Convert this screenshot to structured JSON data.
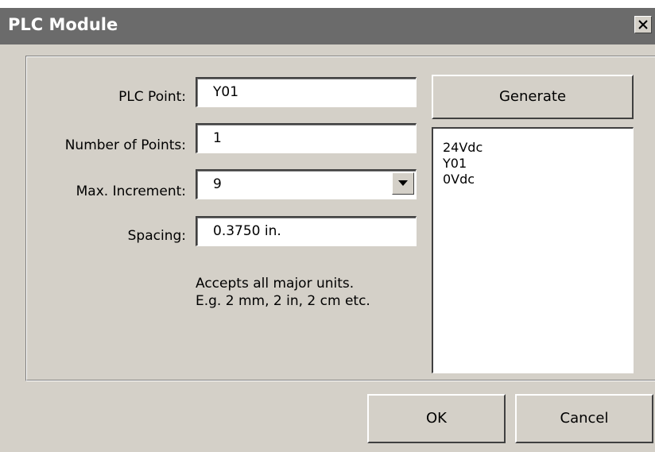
{
  "window": {
    "title": "PLC Module",
    "close_icon": "close-icon"
  },
  "form": {
    "plc_point": {
      "label": "PLC Point:",
      "value": "Y01"
    },
    "number_of_points": {
      "label": "Number of Points:",
      "value": "1"
    },
    "max_increment": {
      "label": "Max. Increment:",
      "value": "9"
    },
    "spacing": {
      "label": "Spacing:",
      "value": "0.3750 in."
    },
    "hint_line1": "Accepts all major units.",
    "hint_line2": "E.g. 2 mm, 2 in, 2 cm etc."
  },
  "generate_button": {
    "label": "Generate"
  },
  "preview_list": {
    "items": [
      "24Vdc",
      "Y01",
      "0Vdc"
    ]
  },
  "footer": {
    "ok_label": "OK",
    "cancel_label": "Cancel"
  }
}
